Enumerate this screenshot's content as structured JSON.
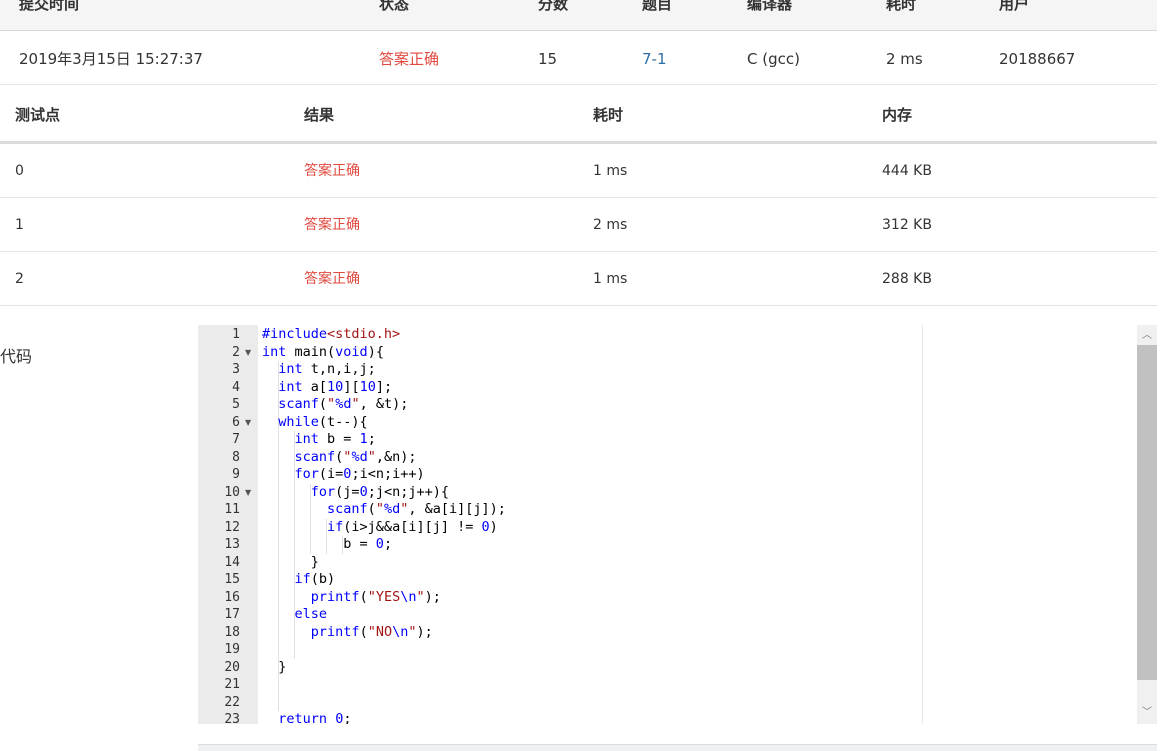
{
  "submission": {
    "headers": [
      "提交时间",
      "状态",
      "分数",
      "题目",
      "编译器",
      "耗时",
      "用户"
    ],
    "time": "2019年3月15日 15:27:37",
    "status": "答案正确",
    "score": "15",
    "problem": "7-1",
    "compiler": "C (gcc)",
    "duration": "2 ms",
    "user": "20188667"
  },
  "testcases": {
    "headers": [
      "测试点",
      "结果",
      "耗时",
      "内存"
    ],
    "rows": [
      {
        "id": "0",
        "result": "答案正确",
        "time": "1 ms",
        "memory": "444 KB"
      },
      {
        "id": "1",
        "result": "答案正确",
        "time": "2 ms",
        "memory": "312 KB"
      },
      {
        "id": "2",
        "result": "答案正确",
        "time": "1 ms",
        "memory": "288 KB"
      }
    ]
  },
  "code": {
    "label": "代码",
    "line_numbers": [
      "1",
      "2",
      "3",
      "4",
      "5",
      "6",
      "7",
      "8",
      "9",
      "10",
      "11",
      "12",
      "13",
      "14",
      "15",
      "16",
      "17",
      "18",
      "19",
      "20",
      "21",
      "22",
      "23"
    ],
    "fold_markers": [
      "2",
      "6",
      "10"
    ],
    "fold_icon": "triangle-down-icon"
  },
  "colors": {
    "accepted": "#e04a3f",
    "link": "#2e6da4",
    "keyword": "#0000ff",
    "string": "#a31515"
  }
}
